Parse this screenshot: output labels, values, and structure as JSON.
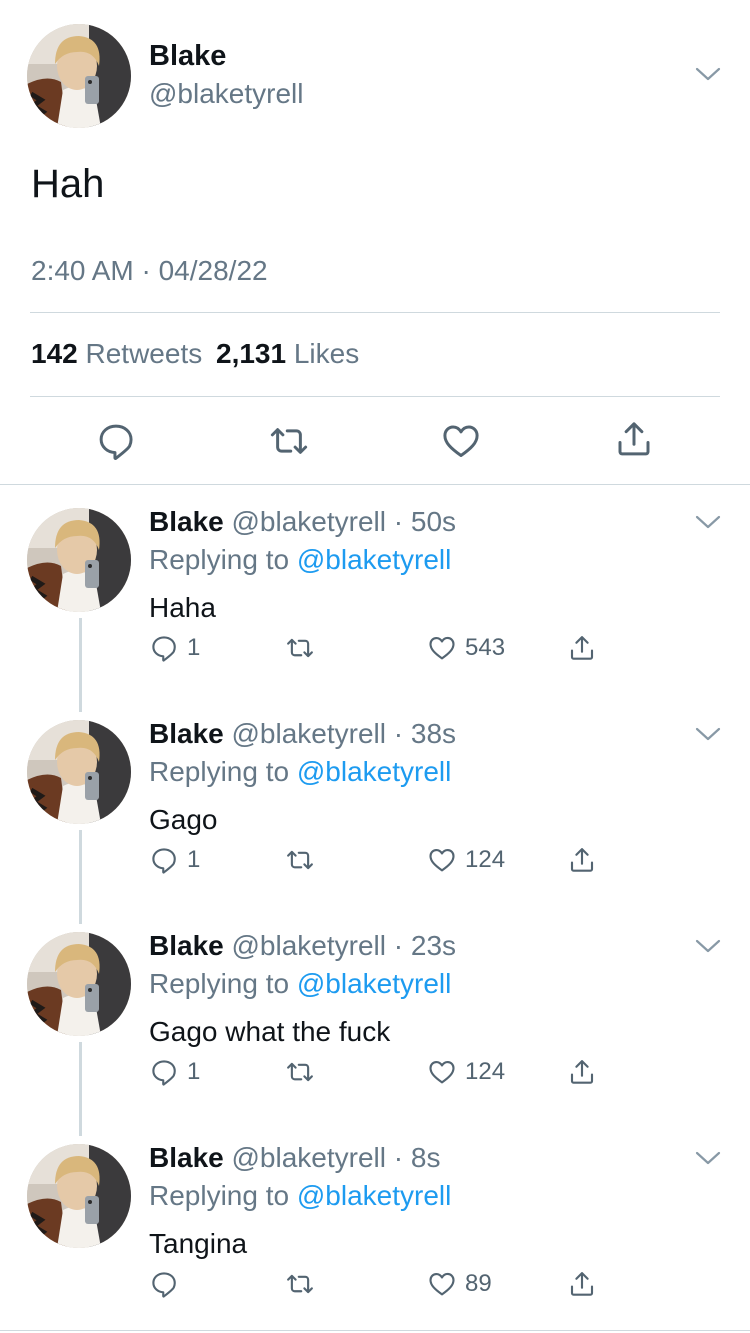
{
  "main_tweet": {
    "name": "Blake",
    "handle": "@blaketyrell",
    "text": "Hah",
    "timestamp": "2:40 AM · 04/28/22",
    "retweets_count": "142",
    "retweets_label": "Retweets",
    "likes_count": "2,131",
    "likes_label": "Likes",
    "actions": [
      "reply-icon",
      "retweet-icon",
      "like-icon",
      "share-icon"
    ]
  },
  "replies": [
    {
      "name": "Blake",
      "handle": "@blaketyrell",
      "time": "50s",
      "replying_prefix": "Replying to",
      "replying_handle": "@blaketyrell",
      "text": "Haha",
      "reply_count": "1",
      "retweet_count": "",
      "like_count": "543"
    },
    {
      "name": "Blake",
      "handle": "@blaketyrell",
      "time": "38s",
      "replying_prefix": "Replying to",
      "replying_handle": "@blaketyrell",
      "text": "Gago",
      "reply_count": "1",
      "retweet_count": "",
      "like_count": "124"
    },
    {
      "name": "Blake",
      "handle": "@blaketyrell",
      "time": "23s",
      "replying_prefix": "Replying to",
      "replying_handle": "@blaketyrell",
      "text": "Gago what the fuck",
      "reply_count": "1",
      "retweet_count": "",
      "like_count": "124"
    },
    {
      "name": "Blake",
      "handle": "@blaketyrell",
      "time": "8s",
      "replying_prefix": "Replying to",
      "replying_handle": "@blaketyrell",
      "text": "Tangina",
      "reply_count": "",
      "retweet_count": "",
      "like_count": "89"
    }
  ],
  "colors": {
    "text": "#0f1419",
    "muted": "#657786",
    "link": "#1d9bf0",
    "divider": "#cfd9de"
  }
}
